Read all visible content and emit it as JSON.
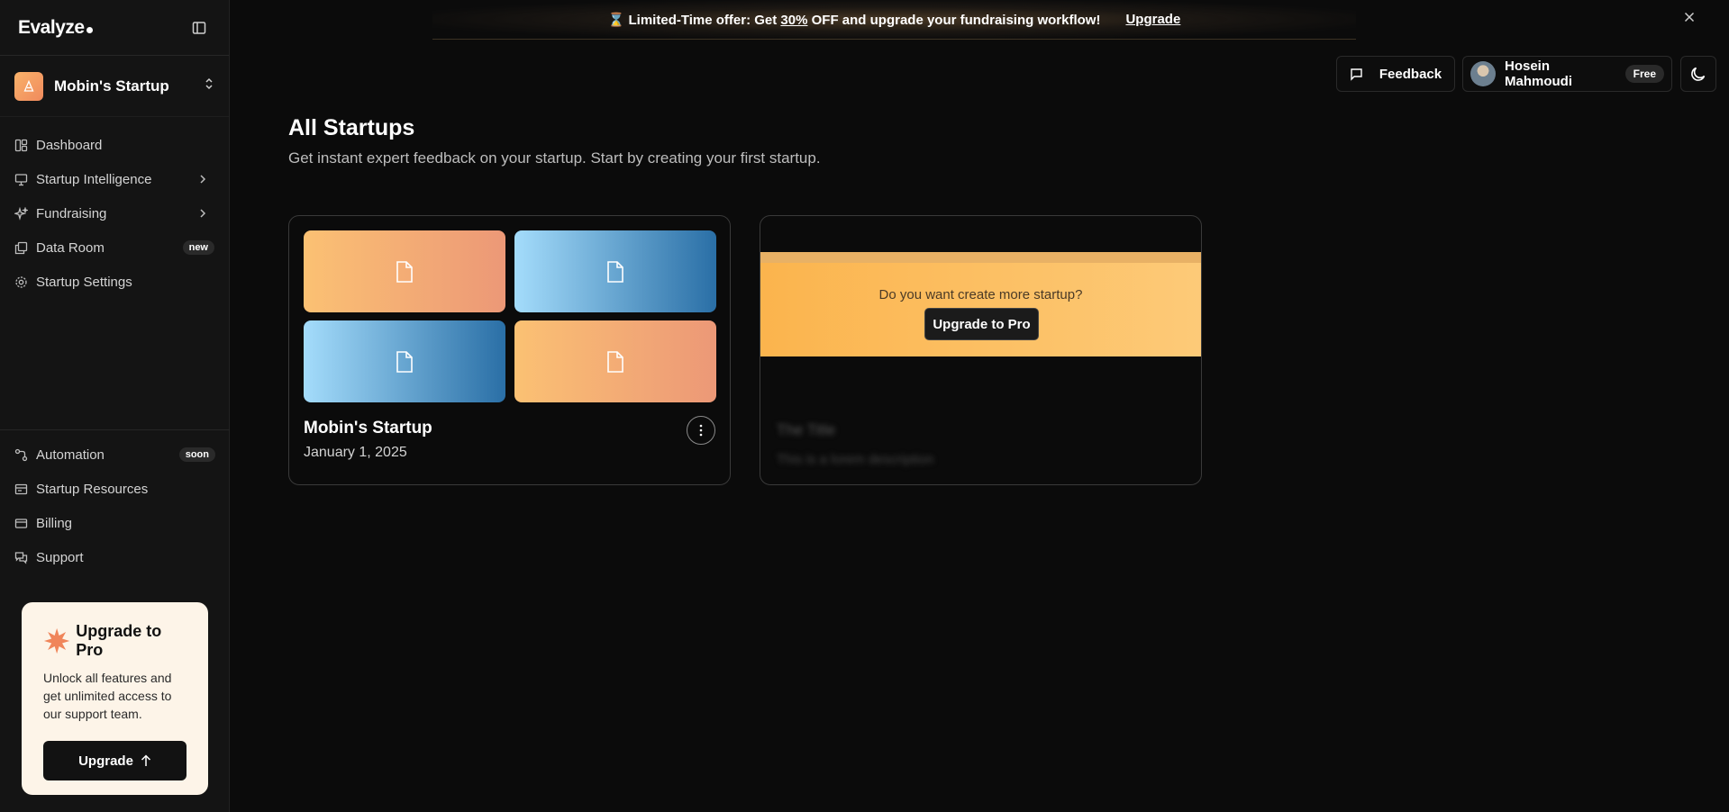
{
  "app": {
    "logo": "Evalyze"
  },
  "sidebar": {
    "startup": {
      "name": "Mobin's Startup"
    },
    "nav": [
      {
        "label": "Dashboard",
        "icon": "dashboard-icon"
      },
      {
        "label": "Startup Intelligence",
        "icon": "presentation-icon",
        "has_submenu": true
      },
      {
        "label": "Fundraising",
        "icon": "sparkles-icon",
        "has_submenu": true
      },
      {
        "label": "Data Room",
        "icon": "documents-icon",
        "badge": "new"
      },
      {
        "label": "Startup Settings",
        "icon": "gear-icon"
      }
    ],
    "nav_bottom": [
      {
        "label": "Automation",
        "icon": "workflow-icon",
        "badge": "soon"
      },
      {
        "label": "Startup Resources",
        "icon": "resources-icon"
      },
      {
        "label": "Billing",
        "icon": "credit-card-icon"
      },
      {
        "label": "Support",
        "icon": "chat-icon"
      }
    ],
    "upgrade_card": {
      "title": "Upgrade to Pro",
      "text": "Unlock all features and get unlimited access to our support team.",
      "button": "Upgrade"
    }
  },
  "banner": {
    "prefix": "⌛ Limited-Time offer: Get ",
    "highlight": "30%",
    "suffix": " OFF and upgrade your fundraising workflow!",
    "link": "Upgrade"
  },
  "header": {
    "feedback_label": "Feedback",
    "user_name": "Hosein Mahmoudi",
    "plan_badge": "Free"
  },
  "main": {
    "title": "All Startups",
    "subtitle": "Get instant expert feedback on your startup. Start by creating your first startup.",
    "startups": [
      {
        "name": "Mobin's Startup",
        "date": "January 1, 2025"
      }
    ],
    "upsell_card": {
      "question": "Do you want create more startup?",
      "button": "Upgrade to Pro",
      "placeholder_title": "The Title",
      "placeholder_description": "This is a lorem description"
    }
  },
  "colors": {
    "background": "#0b0b0b",
    "sidebar": "#141414",
    "accent_orange": "#fbb44d",
    "thumb_blue": "#2a6fa6",
    "upgrade_card_bg": "#fdf4e8"
  }
}
